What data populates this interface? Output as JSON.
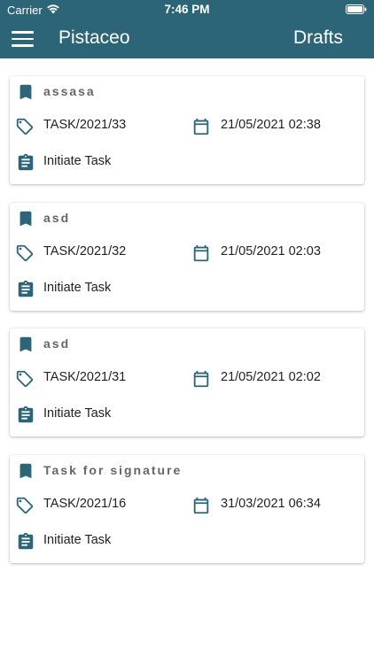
{
  "status_bar": {
    "carrier": "Carrier",
    "time": "7:46 PM"
  },
  "header": {
    "app_name": "Pistaceo",
    "page_title": "Drafts"
  },
  "colors": {
    "primary": "#2c6577",
    "icon": "#2c6577",
    "title_text": "#666666"
  },
  "cards": [
    {
      "title": "assasa",
      "reference": "TASK/2021/33",
      "datetime": "21/05/2021 02:38",
      "status": "Initiate Task"
    },
    {
      "title": "asd",
      "reference": "TASK/2021/32",
      "datetime": "21/05/2021 02:03",
      "status": "Initiate Task"
    },
    {
      "title": "asd",
      "reference": "TASK/2021/31",
      "datetime": "21/05/2021 02:02",
      "status": "Initiate Task"
    },
    {
      "title": "Task for signature",
      "reference": "TASK/2021/16",
      "datetime": "31/03/2021 06:34",
      "status": "Initiate Task"
    }
  ]
}
